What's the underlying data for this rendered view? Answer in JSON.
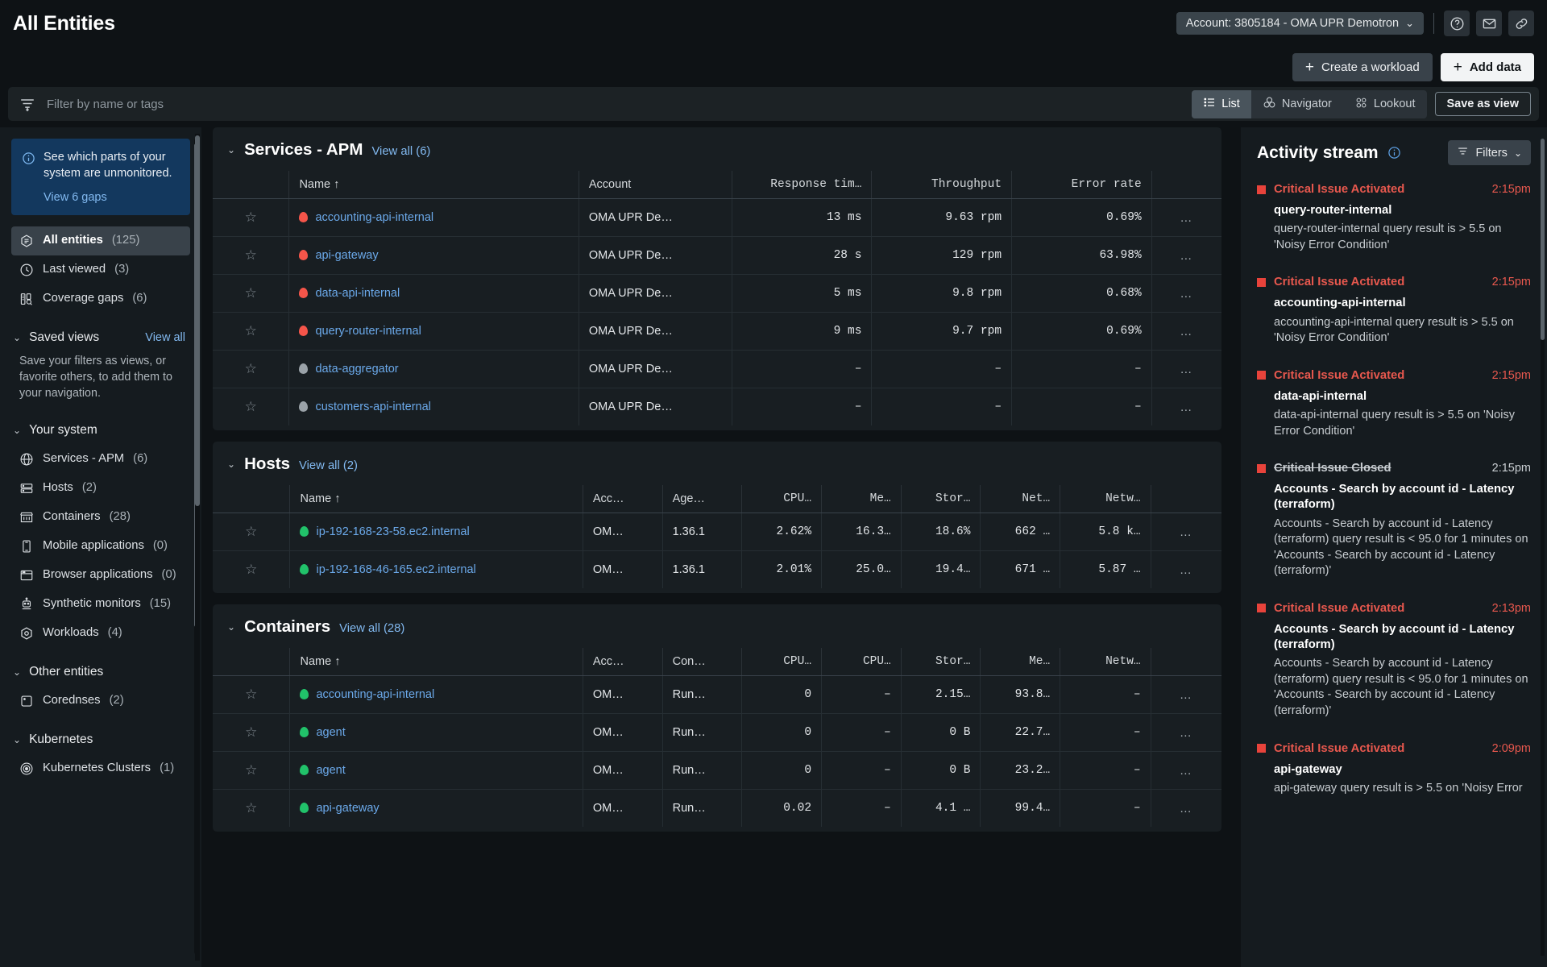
{
  "header": {
    "title": "All Entities",
    "account_label": "Account: 3805184 - OMA UPR Demotron",
    "chevron": "⌄",
    "help_icon": "help-circle-icon",
    "mail_icon": "mail-icon",
    "link_icon": "link-icon",
    "create_workload_label": "Create a workload",
    "add_data_label": "Add data",
    "plus": "+"
  },
  "filterbar": {
    "placeholder": "Filter by name or tags",
    "value": "",
    "views": [
      {
        "label": "List",
        "icon": "list-icon",
        "active": true
      },
      {
        "label": "Navigator",
        "icon": "navigator-icon",
        "active": false
      },
      {
        "label": "Lookout",
        "icon": "lookout-icon",
        "active": false
      }
    ],
    "save_as_view_label": "Save as view"
  },
  "sidebar": {
    "info_card": {
      "text": "See which parts of your system are unmonitored.",
      "link": "View 6 gaps"
    },
    "primary_items": [
      {
        "label": "All entities",
        "count": "(125)",
        "icon": "entity-hex-icon",
        "selected": true
      },
      {
        "label": "Last viewed",
        "count": "(3)",
        "icon": "clock-icon",
        "selected": false
      },
      {
        "label": "Coverage gaps",
        "count": "(6)",
        "icon": "coverage-gaps-icon",
        "selected": false
      }
    ],
    "saved_views": {
      "title": "Saved views",
      "view_all": "View all",
      "description": "Save your filters as views, or favorite others, to add them to your navigation."
    },
    "your_system": {
      "title": "Your system",
      "items": [
        {
          "label": "Services - APM",
          "count": "(6)",
          "icon": "globe-icon"
        },
        {
          "label": "Hosts",
          "count": "(2)",
          "icon": "server-icon"
        },
        {
          "label": "Containers",
          "count": "(28)",
          "icon": "container-icon"
        },
        {
          "label": "Mobile applications",
          "count": "(0)",
          "icon": "mobile-icon"
        },
        {
          "label": "Browser applications",
          "count": "(0)",
          "icon": "browser-icon"
        },
        {
          "label": "Synthetic monitors",
          "count": "(15)",
          "icon": "robot-icon"
        },
        {
          "label": "Workloads",
          "count": "(4)",
          "icon": "workload-hex-icon"
        }
      ]
    },
    "other_entities": {
      "title": "Other entities",
      "items": [
        {
          "label": "Corednses",
          "count": "(2)",
          "icon": "square-dot-icon"
        }
      ]
    },
    "kubernetes": {
      "title": "Kubernetes",
      "items": [
        {
          "label": "Kubernetes Clusters",
          "count": "(1)",
          "icon": "target-icon"
        }
      ]
    }
  },
  "main": {
    "sections": [
      {
        "title": "Services - APM",
        "view_all": "View all (6)",
        "columns": [
          "",
          "Name ↑",
          "Account",
          "Response tim…",
          "Throughput",
          "Error rate",
          ""
        ],
        "rows": [
          {
            "star": "☆",
            "status": "red",
            "name": "accounting-api-internal",
            "account": "OMA UPR De…",
            "c3": "13 ms",
            "c4": "9.63 rpm",
            "c5": "0.69%",
            "menu": "…"
          },
          {
            "star": "☆",
            "status": "red",
            "name": "api-gateway",
            "account": "OMA UPR De…",
            "c3": "28 s",
            "c4": "129 rpm",
            "c5": "63.98%",
            "menu": "…"
          },
          {
            "star": "☆",
            "status": "red",
            "name": "data-api-internal",
            "account": "OMA UPR De…",
            "c3": "5 ms",
            "c4": "9.8 rpm",
            "c5": "0.68%",
            "menu": "…"
          },
          {
            "star": "☆",
            "status": "red",
            "name": "query-router-internal",
            "account": "OMA UPR De…",
            "c3": "9 ms",
            "c4": "9.7 rpm",
            "c5": "0.69%",
            "menu": "…"
          },
          {
            "star": "☆",
            "status": "gray",
            "name": "data-aggregator",
            "account": "OMA UPR De…",
            "c3": "–",
            "c4": "–",
            "c5": "–",
            "menu": "…"
          },
          {
            "star": "☆",
            "status": "gray",
            "name": "customers-api-internal",
            "account": "OMA UPR De…",
            "c3": "–",
            "c4": "–",
            "c5": "–",
            "menu": "…"
          }
        ]
      },
      {
        "title": "Hosts",
        "view_all": "View all (2)",
        "columns": [
          "",
          "Name ↑",
          "Acc…",
          "Age…",
          "CPU…",
          "Me…",
          "Stor…",
          "Net…",
          "Netw…",
          ""
        ],
        "rows": [
          {
            "star": "☆",
            "status": "green",
            "name": "ip-192-168-23-58.ec2.internal",
            "account": "OM…",
            "c3": "1.36.1",
            "c4": "2.62%",
            "c5": "16.3…",
            "c6": "18.6%",
            "c7": "662 …",
            "c8": "5.8 k…",
            "menu": "…"
          },
          {
            "star": "☆",
            "status": "green",
            "name": "ip-192-168-46-165.ec2.internal",
            "account": "OM…",
            "c3": "1.36.1",
            "c4": "2.01%",
            "c5": "25.0…",
            "c6": "19.4…",
            "c7": "671 …",
            "c8": "5.87 …",
            "menu": "…"
          }
        ]
      },
      {
        "title": "Containers",
        "view_all": "View all (28)",
        "columns": [
          "",
          "Name ↑",
          "Acc…",
          "Con…",
          "CPU…",
          "CPU…",
          "Stor…",
          "Me…",
          "Netw…",
          ""
        ],
        "rows": [
          {
            "star": "☆",
            "status": "green",
            "name": "accounting-api-internal",
            "account": "OM…",
            "c3": "Run…",
            "c4": "0",
            "c5": "–",
            "c6": "2.15…",
            "c7": "93.8…",
            "c8": "–",
            "menu": "…"
          },
          {
            "star": "☆",
            "status": "green",
            "name": "agent",
            "account": "OM…",
            "c3": "Run…",
            "c4": "0",
            "c5": "–",
            "c6": "0 B",
            "c7": "22.7…",
            "c8": "–",
            "menu": "…"
          },
          {
            "star": "☆",
            "status": "green",
            "name": "agent",
            "account": "OM…",
            "c3": "Run…",
            "c4": "0",
            "c5": "–",
            "c6": "0 B",
            "c7": "23.2…",
            "c8": "–",
            "menu": "…"
          },
          {
            "star": "☆",
            "status": "green",
            "name": "api-gateway",
            "account": "OM…",
            "c3": "Run…",
            "c4": "0.02",
            "c5": "–",
            "c6": "4.1 …",
            "c7": "99.4…",
            "c8": "–",
            "menu": "…"
          }
        ]
      }
    ]
  },
  "activity": {
    "title": "Activity stream",
    "filters_label": "Filters",
    "chevron": "⌄",
    "items": [
      {
        "kind": "Critical Issue Activated",
        "closed": false,
        "time": "2:15pm",
        "name": "query-router-internal",
        "desc": "query-router-internal query result is > 5.5 on 'Noisy Error Condition'"
      },
      {
        "kind": "Critical Issue Activated",
        "closed": false,
        "time": "2:15pm",
        "name": "accounting-api-internal",
        "desc": "accounting-api-internal query result is > 5.5 on 'Noisy Error Condition'"
      },
      {
        "kind": "Critical Issue Activated",
        "closed": false,
        "time": "2:15pm",
        "name": "data-api-internal",
        "desc": "data-api-internal query result is > 5.5 on 'Noisy Error Condition'"
      },
      {
        "kind": "Critical Issue Closed",
        "closed": true,
        "time": "2:15pm",
        "name": "Accounts - Search by account id - Latency (terraform)",
        "desc": "Accounts - Search by account id - Latency (terraform) query result is < 95.0 for 1 minutes on 'Accounts - Search by account id - Latency (terraform)'"
      },
      {
        "kind": "Critical Issue Activated",
        "closed": false,
        "time": "2:13pm",
        "name": "Accounts - Search by account id - Latency (terraform)",
        "desc": "Accounts - Search by account id - Latency (terraform) query result is < 95.0 for 1 minutes on 'Accounts - Search by account id - Latency (terraform)'"
      },
      {
        "kind": "Critical Issue Activated",
        "closed": false,
        "time": "2:09pm",
        "name": "api-gateway",
        "desc": "api-gateway query result is > 5.5 on 'Noisy Error"
      }
    ]
  },
  "colors": {
    "critical": "#e8433b",
    "link": "#6ba9ea",
    "healthy": "#21c26a",
    "unknown": "#9aa2a8",
    "info_card_bg": "#13385e"
  }
}
